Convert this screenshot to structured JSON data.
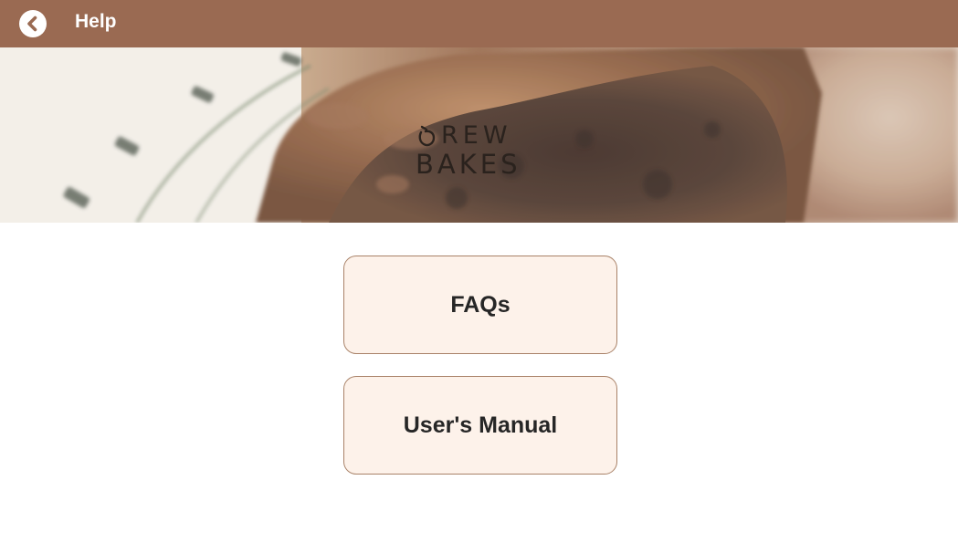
{
  "header": {
    "title": "Help",
    "back_icon": "chevron-left-icon",
    "background_color": "#9a6a52"
  },
  "banner": {
    "logo_line1": "REW",
    "logo_line2": "BAKES"
  },
  "menu": {
    "faqs_label": "FAQs",
    "manual_label": "User's Manual",
    "button_background": "#fdf2ea",
    "button_border": "#a98268"
  }
}
